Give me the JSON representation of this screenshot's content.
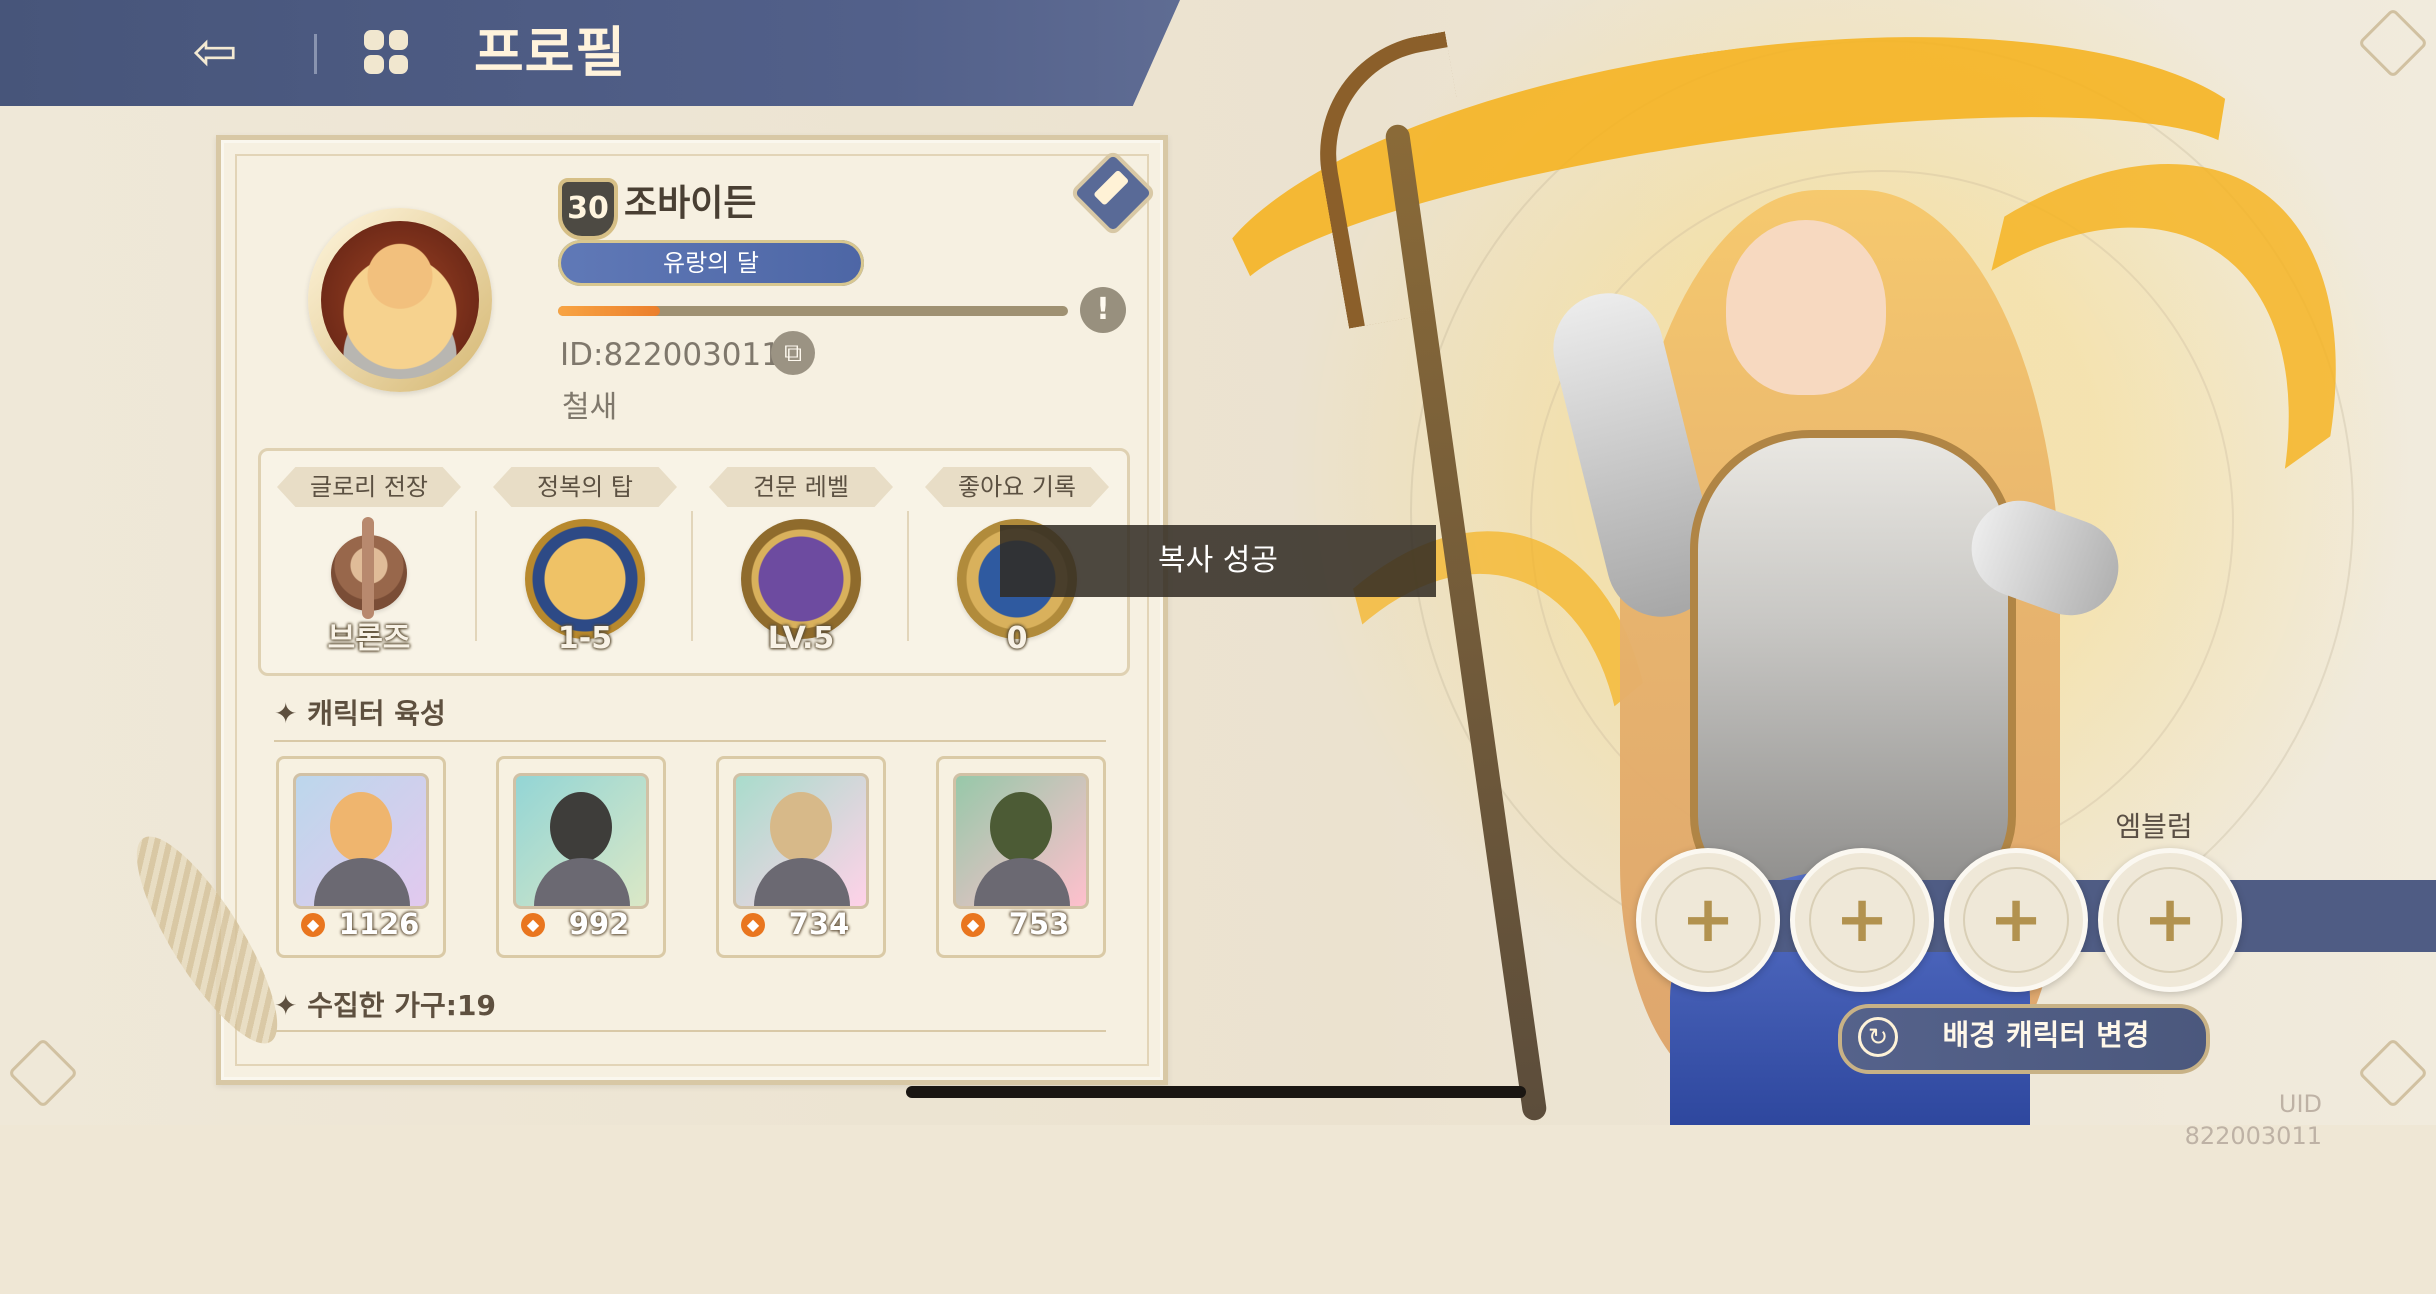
{
  "header": {
    "title": "프로필",
    "back_icon": "back-arrow-icon",
    "menu_icon": "menu-grid-icon"
  },
  "profile": {
    "level": "30",
    "name": "조바이든",
    "title_badge": "유랑의 달",
    "progress_percent": 20,
    "id_text": "ID:822003011",
    "guild": "철새"
  },
  "stats": [
    {
      "label": "글로리 전장",
      "value": "브론즈"
    },
    {
      "label": "정복의 탑",
      "value": "1-5"
    },
    {
      "label": "견문 레벨",
      "value": "LV.5"
    },
    {
      "label": "좋아요 기록",
      "value": "0"
    }
  ],
  "sections": {
    "character_training": "캐릭터 육성",
    "collected_furniture": "수집한 가구:19"
  },
  "heroes": [
    {
      "power": "1126"
    },
    {
      "power": "992"
    },
    {
      "power": "734"
    },
    {
      "power": "753"
    }
  ],
  "toast": {
    "message": "복사 성공"
  },
  "emblems": {
    "label": "엠블럼",
    "slots": [
      "+",
      "+",
      "+",
      "+"
    ]
  },
  "actions": {
    "change_background_character": "배경 캐릭터 변경"
  },
  "footer": {
    "watermark": "UID 822003011"
  },
  "colors": {
    "header": "#4f5c84",
    "card_bg": "#f6f0e1",
    "accent_gold": "#d2b06b",
    "badge_blue": "#5a72b0",
    "exp_fill": "#f29a3d"
  }
}
